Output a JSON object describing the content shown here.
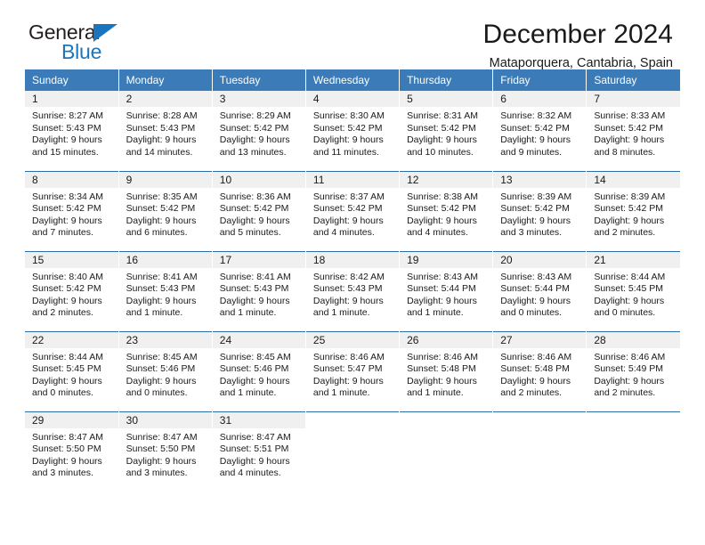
{
  "brand": {
    "name_top": "General",
    "name_bottom": "Blue",
    "accent_color": "#1b75bc"
  },
  "header": {
    "title": "December 2024",
    "subtitle": "Mataporquera, Cantabria, Spain"
  },
  "theme": {
    "header_blue": "#3b7cb8",
    "rule_blue": "#2e6da4",
    "daynum_band": "#f0f0f0"
  },
  "weekday_headers": [
    "Sunday",
    "Monday",
    "Tuesday",
    "Wednesday",
    "Thursday",
    "Friday",
    "Saturday"
  ],
  "weeks": [
    [
      {
        "day": "1",
        "sunrise": "Sunrise: 8:27 AM",
        "sunset": "Sunset: 5:43 PM",
        "daylight_line1": "Daylight: 9 hours",
        "daylight_line2": "and 15 minutes."
      },
      {
        "day": "2",
        "sunrise": "Sunrise: 8:28 AM",
        "sunset": "Sunset: 5:43 PM",
        "daylight_line1": "Daylight: 9 hours",
        "daylight_line2": "and 14 minutes."
      },
      {
        "day": "3",
        "sunrise": "Sunrise: 8:29 AM",
        "sunset": "Sunset: 5:42 PM",
        "daylight_line1": "Daylight: 9 hours",
        "daylight_line2": "and 13 minutes."
      },
      {
        "day": "4",
        "sunrise": "Sunrise: 8:30 AM",
        "sunset": "Sunset: 5:42 PM",
        "daylight_line1": "Daylight: 9 hours",
        "daylight_line2": "and 11 minutes."
      },
      {
        "day": "5",
        "sunrise": "Sunrise: 8:31 AM",
        "sunset": "Sunset: 5:42 PM",
        "daylight_line1": "Daylight: 9 hours",
        "daylight_line2": "and 10 minutes."
      },
      {
        "day": "6",
        "sunrise": "Sunrise: 8:32 AM",
        "sunset": "Sunset: 5:42 PM",
        "daylight_line1": "Daylight: 9 hours",
        "daylight_line2": "and 9 minutes."
      },
      {
        "day": "7",
        "sunrise": "Sunrise: 8:33 AM",
        "sunset": "Sunset: 5:42 PM",
        "daylight_line1": "Daylight: 9 hours",
        "daylight_line2": "and 8 minutes."
      }
    ],
    [
      {
        "day": "8",
        "sunrise": "Sunrise: 8:34 AM",
        "sunset": "Sunset: 5:42 PM",
        "daylight_line1": "Daylight: 9 hours",
        "daylight_line2": "and 7 minutes."
      },
      {
        "day": "9",
        "sunrise": "Sunrise: 8:35 AM",
        "sunset": "Sunset: 5:42 PM",
        "daylight_line1": "Daylight: 9 hours",
        "daylight_line2": "and 6 minutes."
      },
      {
        "day": "10",
        "sunrise": "Sunrise: 8:36 AM",
        "sunset": "Sunset: 5:42 PM",
        "daylight_line1": "Daylight: 9 hours",
        "daylight_line2": "and 5 minutes."
      },
      {
        "day": "11",
        "sunrise": "Sunrise: 8:37 AM",
        "sunset": "Sunset: 5:42 PM",
        "daylight_line1": "Daylight: 9 hours",
        "daylight_line2": "and 4 minutes."
      },
      {
        "day": "12",
        "sunrise": "Sunrise: 8:38 AM",
        "sunset": "Sunset: 5:42 PM",
        "daylight_line1": "Daylight: 9 hours",
        "daylight_line2": "and 4 minutes."
      },
      {
        "day": "13",
        "sunrise": "Sunrise: 8:39 AM",
        "sunset": "Sunset: 5:42 PM",
        "daylight_line1": "Daylight: 9 hours",
        "daylight_line2": "and 3 minutes."
      },
      {
        "day": "14",
        "sunrise": "Sunrise: 8:39 AM",
        "sunset": "Sunset: 5:42 PM",
        "daylight_line1": "Daylight: 9 hours",
        "daylight_line2": "and 2 minutes."
      }
    ],
    [
      {
        "day": "15",
        "sunrise": "Sunrise: 8:40 AM",
        "sunset": "Sunset: 5:42 PM",
        "daylight_line1": "Daylight: 9 hours",
        "daylight_line2": "and 2 minutes."
      },
      {
        "day": "16",
        "sunrise": "Sunrise: 8:41 AM",
        "sunset": "Sunset: 5:43 PM",
        "daylight_line1": "Daylight: 9 hours",
        "daylight_line2": "and 1 minute."
      },
      {
        "day": "17",
        "sunrise": "Sunrise: 8:41 AM",
        "sunset": "Sunset: 5:43 PM",
        "daylight_line1": "Daylight: 9 hours",
        "daylight_line2": "and 1 minute."
      },
      {
        "day": "18",
        "sunrise": "Sunrise: 8:42 AM",
        "sunset": "Sunset: 5:43 PM",
        "daylight_line1": "Daylight: 9 hours",
        "daylight_line2": "and 1 minute."
      },
      {
        "day": "19",
        "sunrise": "Sunrise: 8:43 AM",
        "sunset": "Sunset: 5:44 PM",
        "daylight_line1": "Daylight: 9 hours",
        "daylight_line2": "and 1 minute."
      },
      {
        "day": "20",
        "sunrise": "Sunrise: 8:43 AM",
        "sunset": "Sunset: 5:44 PM",
        "daylight_line1": "Daylight: 9 hours",
        "daylight_line2": "and 0 minutes."
      },
      {
        "day": "21",
        "sunrise": "Sunrise: 8:44 AM",
        "sunset": "Sunset: 5:45 PM",
        "daylight_line1": "Daylight: 9 hours",
        "daylight_line2": "and 0 minutes."
      }
    ],
    [
      {
        "day": "22",
        "sunrise": "Sunrise: 8:44 AM",
        "sunset": "Sunset: 5:45 PM",
        "daylight_line1": "Daylight: 9 hours",
        "daylight_line2": "and 0 minutes."
      },
      {
        "day": "23",
        "sunrise": "Sunrise: 8:45 AM",
        "sunset": "Sunset: 5:46 PM",
        "daylight_line1": "Daylight: 9 hours",
        "daylight_line2": "and 0 minutes."
      },
      {
        "day": "24",
        "sunrise": "Sunrise: 8:45 AM",
        "sunset": "Sunset: 5:46 PM",
        "daylight_line1": "Daylight: 9 hours",
        "daylight_line2": "and 1 minute."
      },
      {
        "day": "25",
        "sunrise": "Sunrise: 8:46 AM",
        "sunset": "Sunset: 5:47 PM",
        "daylight_line1": "Daylight: 9 hours",
        "daylight_line2": "and 1 minute."
      },
      {
        "day": "26",
        "sunrise": "Sunrise: 8:46 AM",
        "sunset": "Sunset: 5:48 PM",
        "daylight_line1": "Daylight: 9 hours",
        "daylight_line2": "and 1 minute."
      },
      {
        "day": "27",
        "sunrise": "Sunrise: 8:46 AM",
        "sunset": "Sunset: 5:48 PM",
        "daylight_line1": "Daylight: 9 hours",
        "daylight_line2": "and 2 minutes."
      },
      {
        "day": "28",
        "sunrise": "Sunrise: 8:46 AM",
        "sunset": "Sunset: 5:49 PM",
        "daylight_line1": "Daylight: 9 hours",
        "daylight_line2": "and 2 minutes."
      }
    ],
    [
      {
        "day": "29",
        "sunrise": "Sunrise: 8:47 AM",
        "sunset": "Sunset: 5:50 PM",
        "daylight_line1": "Daylight: 9 hours",
        "daylight_line2": "and 3 minutes."
      },
      {
        "day": "30",
        "sunrise": "Sunrise: 8:47 AM",
        "sunset": "Sunset: 5:50 PM",
        "daylight_line1": "Daylight: 9 hours",
        "daylight_line2": "and 3 minutes."
      },
      {
        "day": "31",
        "sunrise": "Sunrise: 8:47 AM",
        "sunset": "Sunset: 5:51 PM",
        "daylight_line1": "Daylight: 9 hours",
        "daylight_line2": "and 4 minutes."
      },
      {
        "day": "",
        "sunrise": "",
        "sunset": "",
        "daylight_line1": "",
        "daylight_line2": ""
      },
      {
        "day": "",
        "sunrise": "",
        "sunset": "",
        "daylight_line1": "",
        "daylight_line2": ""
      },
      {
        "day": "",
        "sunrise": "",
        "sunset": "",
        "daylight_line1": "",
        "daylight_line2": ""
      },
      {
        "day": "",
        "sunrise": "",
        "sunset": "",
        "daylight_line1": "",
        "daylight_line2": ""
      }
    ]
  ]
}
